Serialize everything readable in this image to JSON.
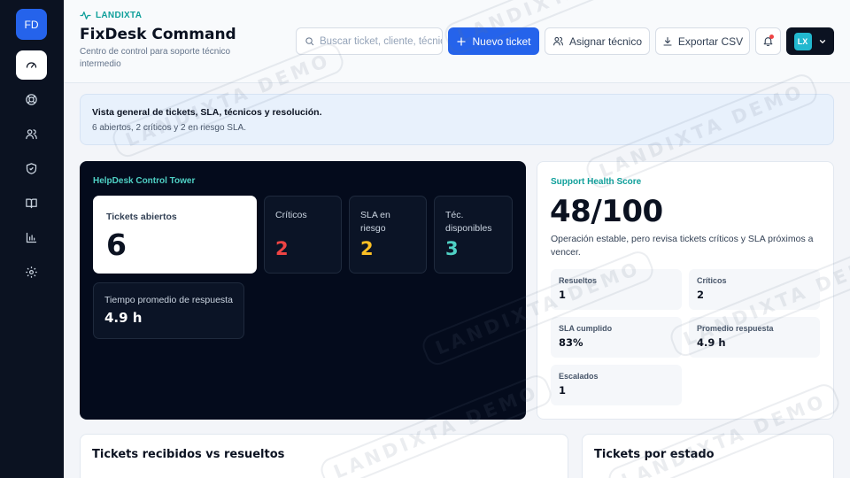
{
  "sidebar": {
    "avatar_initials": "FD",
    "items": [
      {
        "name": "dashboard",
        "icon": "gauge-icon",
        "active": true
      },
      {
        "name": "support",
        "icon": "lifebuoy-icon",
        "active": false
      },
      {
        "name": "users",
        "icon": "users-icon",
        "active": false
      },
      {
        "name": "security",
        "icon": "shield-icon",
        "active": false
      },
      {
        "name": "knowledge-base",
        "icon": "book-icon",
        "active": false
      },
      {
        "name": "reports",
        "icon": "bar-chart-icon",
        "active": false
      },
      {
        "name": "settings",
        "icon": "gear-icon",
        "active": false
      }
    ]
  },
  "header": {
    "brand": "LANDIXTA",
    "title": "FixDesk Command",
    "subtitle": "Centro de control para soporte técnico intermedio",
    "search_placeholder": "Buscar ticket, cliente, técnico",
    "new_ticket_label": "Nuevo ticket",
    "assign_label": "Asignar técnico",
    "export_label": "Exportar CSV",
    "user_initials": "LX"
  },
  "banner": {
    "title": "Vista general de tickets, SLA, técnicos y resolución.",
    "text": "6 abiertos, 2 críticos y 2 en riesgo SLA."
  },
  "tower": {
    "label": "HelpDesk Control Tower",
    "open_label": "Tickets abiertos",
    "open_value": "6",
    "critical_label": "Críticos",
    "critical_value": "2",
    "sla_label": "SLA en riesgo",
    "sla_value": "2",
    "techs_label": "Téc. disponibles",
    "techs_value": "3",
    "response_label": "Tiempo promedio de respuesta",
    "response_value": "4.9 h"
  },
  "health": {
    "label": "Support Health Score",
    "score": "48/100",
    "description": "Operación estable, pero revisa tickets críticos y SLA próximos a vencer.",
    "metrics": [
      {
        "label": "Resueltos",
        "value": "1"
      },
      {
        "label": "Críticos",
        "value": "2"
      },
      {
        "label": "SLA cumplido",
        "value": "83%"
      },
      {
        "label": "Promedio respuesta",
        "value": "4.9 h"
      },
      {
        "label": "Escalados",
        "value": "1"
      }
    ]
  },
  "cards": {
    "received_vs_resolved": "Tickets recibidos vs resueltos",
    "by_status": "Tickets por estado"
  },
  "watermark": "LANDIXTA DEMO",
  "colors": {
    "primary": "#2563eb",
    "accent": "#0e9f9a",
    "critical": "#ef4444",
    "warning": "#fbbf24",
    "success": "#4fd1c5",
    "dark": "#040b1c"
  }
}
